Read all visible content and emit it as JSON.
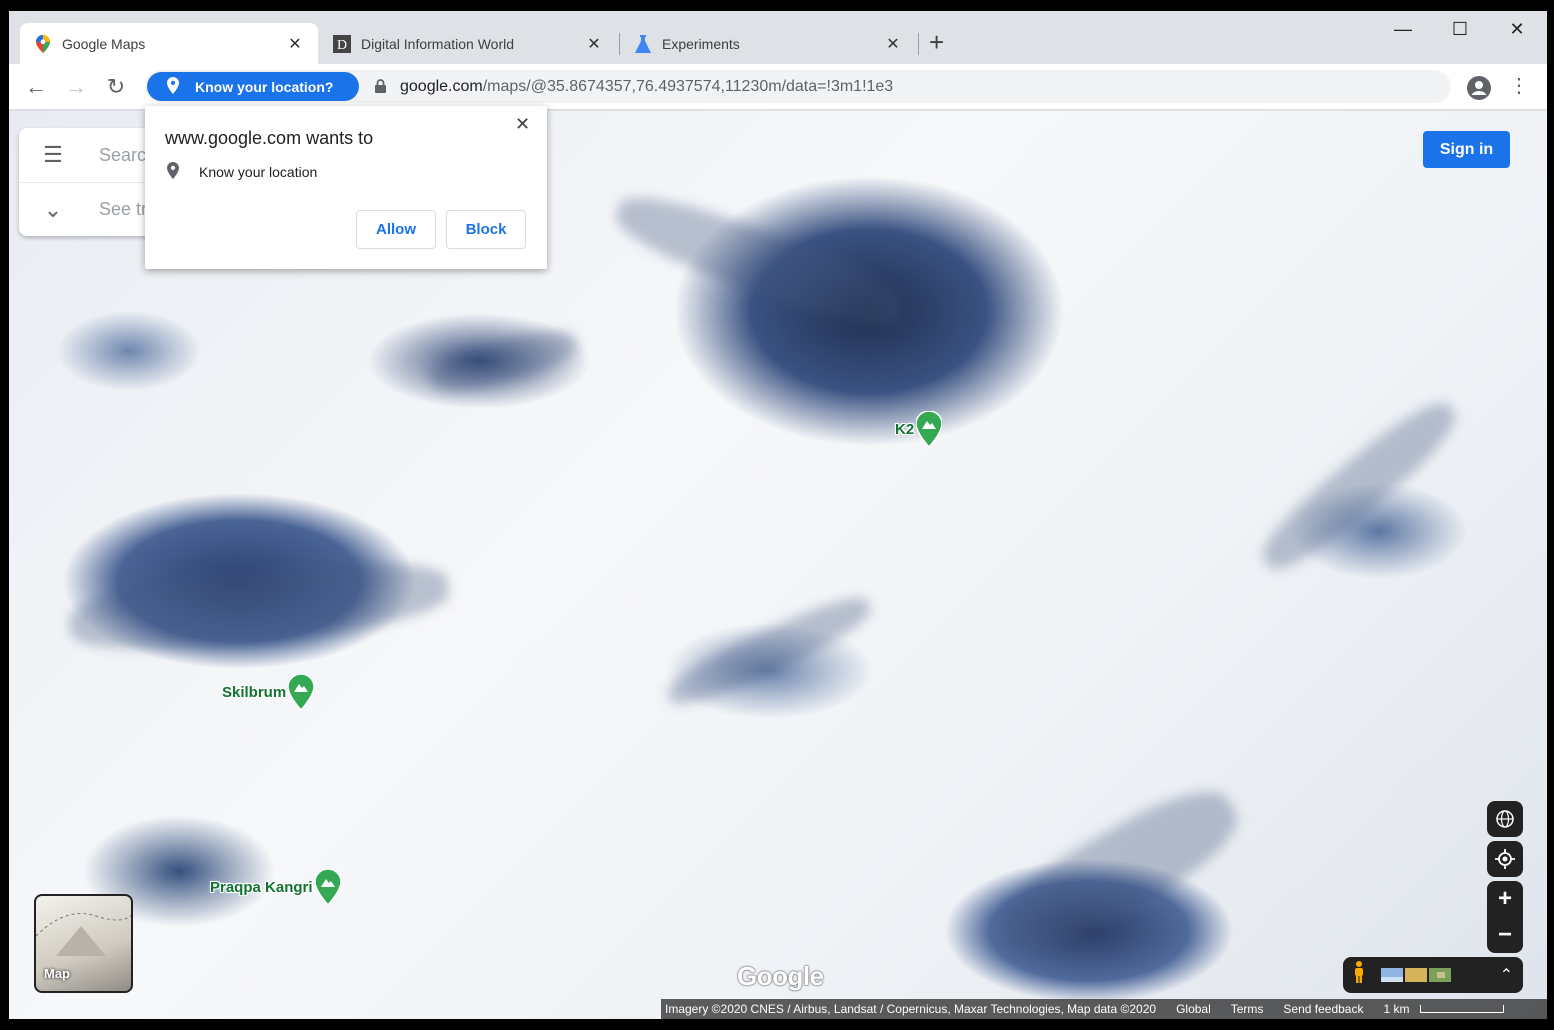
{
  "browser": {
    "tabs": [
      {
        "title": "Google Maps",
        "icon": "google-maps-icon"
      },
      {
        "title": "Digital Information World",
        "icon": "dinfo-world-icon"
      },
      {
        "title": "Experiments",
        "icon": "flask-icon"
      }
    ],
    "tab_close": "✕",
    "new_tab": "+",
    "window_controls": {
      "minimize": "—",
      "maximize": "☐",
      "close": "✕"
    },
    "nav": {
      "back": "←",
      "forward": "→",
      "reload": "↻"
    },
    "permission_chip": "Know your location?",
    "url_host": "google.com",
    "url_path": "/maps/@35.8674357,76.4937574,11230m/data=!3m1!1e3",
    "menu": "⋮"
  },
  "popup": {
    "title": "www.google.com wants to",
    "permission": "Know your location",
    "allow": "Allow",
    "block": "Block",
    "close": "✕"
  },
  "maps": {
    "search_placeholder": "Searc",
    "see_text": "See tr",
    "sign_in": "Sign in",
    "poi": [
      {
        "name": "K2"
      },
      {
        "name": "Skilbrum"
      },
      {
        "name": "Praqpa Kangri"
      }
    ],
    "layer_label": "Map",
    "watermark": "Google",
    "attribution": {
      "imagery": "Imagery ©2020 CNES / Airbus, Landsat / Copernicus, Maxar Technologies, Map data ©2020",
      "global": "Global",
      "terms": "Terms",
      "feedback": "Send feedback",
      "scale": "1 km"
    },
    "colors": {
      "accent": "#1a73e8",
      "poi": "#34a853"
    }
  }
}
